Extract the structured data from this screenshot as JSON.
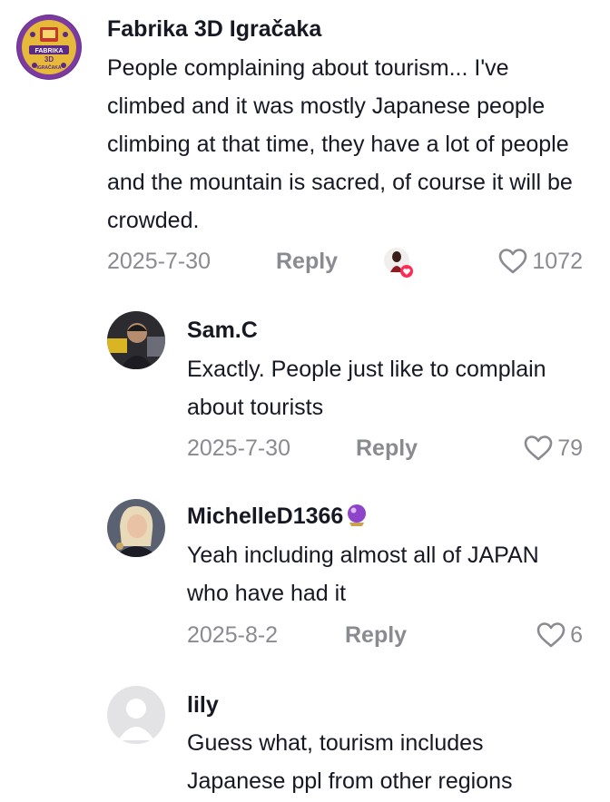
{
  "comments": [
    {
      "username": "Fabrika 3D Igračaka",
      "avatar_label": "FABRIKA 3D IGRAČAKA",
      "text": "People complaining about tourism... I've climbed and it was mostly Japanese people climbing at that time, they have a lot of people and the mountain is sacred, of course it will be crowded.",
      "date": "2025-7-30",
      "reply_label": "Reply",
      "likes": "1072"
    }
  ],
  "replies": [
    {
      "username": "Sam.C",
      "text": "Exactly. People just like to complain about tourists",
      "date": "2025-7-30",
      "reply_label": "Reply",
      "likes": "79"
    },
    {
      "username": "MichelleD1366",
      "username_emoji": "crystal-ball-icon",
      "text": "Yeah including almost all of JAPAN who have had it",
      "date": "2025-8-2",
      "reply_label": "Reply",
      "likes": "6"
    },
    {
      "username": "lily",
      "text": "Guess what, tourism includes Japanese ppl from other regions"
    }
  ],
  "colors": {
    "text": "#161823",
    "muted": "#8a8b91",
    "creator_like_badge": "#fe2c55"
  }
}
